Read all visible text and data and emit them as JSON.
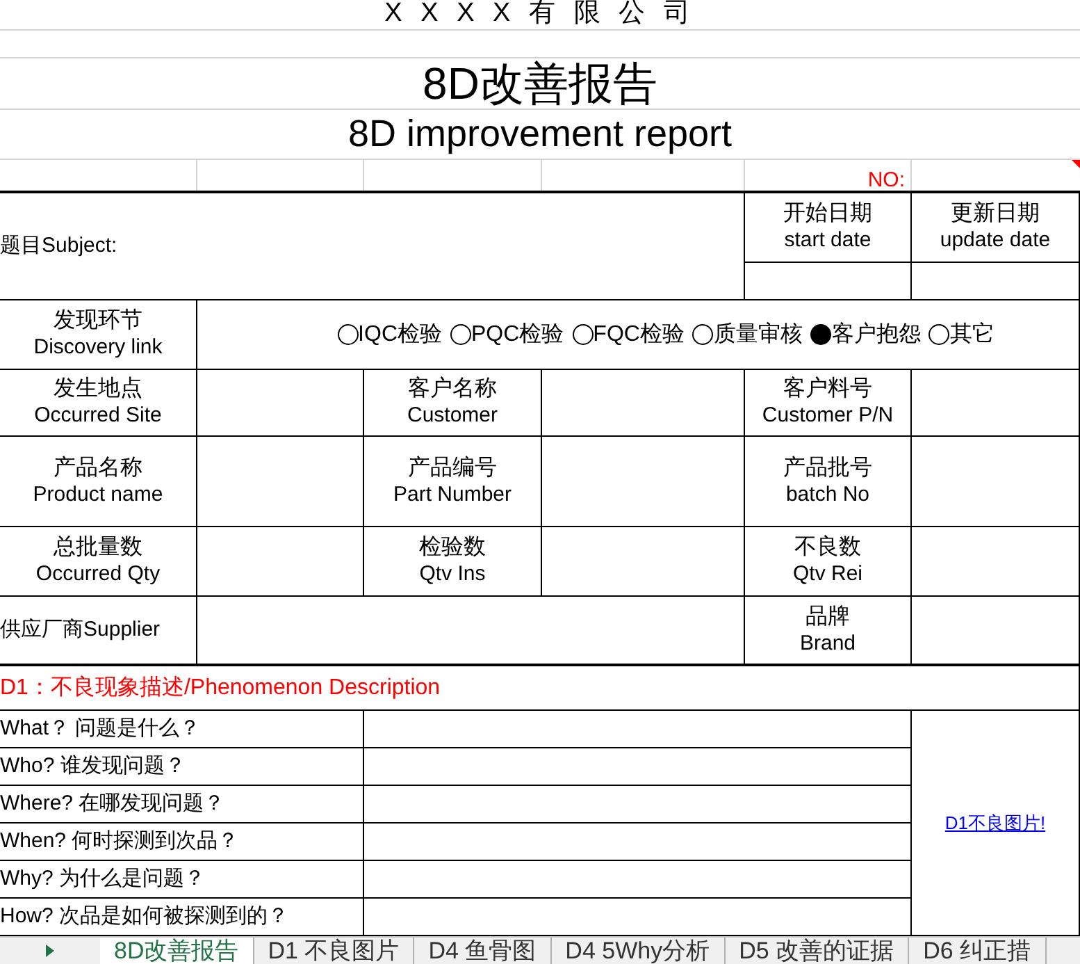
{
  "company": "X X X X 有 限 公 司",
  "title_zh": "8D改善报告",
  "title_en": "8D improvement report",
  "no_label": "NO:",
  "subject_label": "题目Subject:",
  "dates": [
    {
      "zh": "开始日期",
      "en": "start date"
    },
    {
      "zh": "更新日期",
      "en": "update date"
    }
  ],
  "discovery": {
    "zh": "发现环节",
    "en": "Discovery link",
    "options": [
      {
        "label": "IQC检验",
        "selected": false
      },
      {
        "label": "PQC检验",
        "selected": false
      },
      {
        "label": "FQC检验",
        "selected": false
      },
      {
        "label": "质量审核",
        "selected": false
      },
      {
        "label": "客户抱怨",
        "selected": true
      },
      {
        "label": "其它",
        "selected": false
      }
    ]
  },
  "info_rows": [
    [
      {
        "zh": "发生地点",
        "en": "Occurred Site"
      },
      {
        "zh": "客户名称",
        "en": "Customer"
      },
      {
        "zh": "客户料号",
        "en": "Customer P/N"
      }
    ],
    [
      {
        "zh": "产品名称",
        "en": "Product name"
      },
      {
        "zh": "产品编号",
        "en": "Part Number"
      },
      {
        "zh": "产品批号",
        "en": "batch No"
      }
    ],
    [
      {
        "zh": "总批量数",
        "en": "Occurred Qty"
      },
      {
        "zh": "检验数",
        "en": "Qtv Ins"
      },
      {
        "zh": "不良数",
        "en": "Qtv Rei"
      }
    ]
  ],
  "supplier_label": "供应厂商Supplier",
  "brand": {
    "zh": "品牌",
    "en": "Brand"
  },
  "d1": {
    "heading": "D1：不良现象描述/Phenomenon Description",
    "questions": [
      "What？ 问题是什么？",
      "Who? 谁发现问题？",
      "Where? 在哪发现问题？",
      "When? 何时探测到次品？",
      "Why? 为什么是问题？",
      "How? 次品是如何被探测到的？"
    ],
    "picture_link": "D1不良图片!"
  },
  "sheet_tabs": [
    {
      "label": "8D改善报告",
      "selected": true
    },
    {
      "label": "D1 不良图片",
      "selected": false
    },
    {
      "label": "D4 鱼骨图",
      "selected": false
    },
    {
      "label": "D4 5Why分析",
      "selected": false
    },
    {
      "label": "D5 改善的证据",
      "selected": false
    },
    {
      "label": "D6 纠正措",
      "selected": false
    }
  ]
}
